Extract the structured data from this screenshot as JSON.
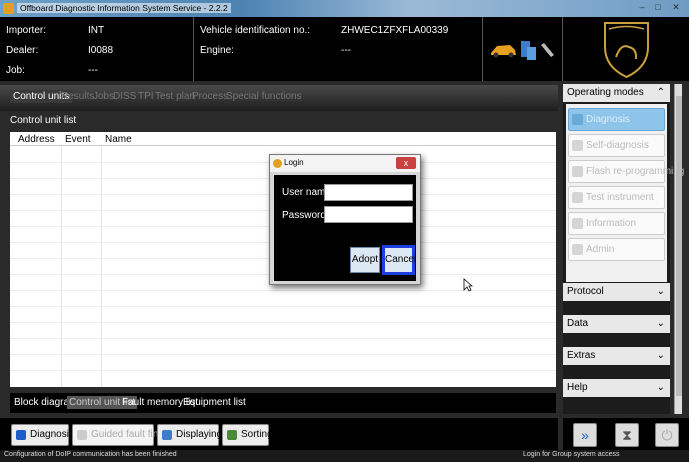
{
  "window": {
    "title": "Offboard Diagnostic Information System Service - 2.2.2"
  },
  "info": {
    "importer_label": "Importer:",
    "importer_value": "INT",
    "dealer_label": "Dealer:",
    "dealer_value": "I0088",
    "job_label": "Job:",
    "job_value": "---",
    "vin_label": "Vehicle identification no.:",
    "vin_value": "ZHWEC1ZFXFLA00339",
    "engine_label": "Engine:",
    "engine_value": "---"
  },
  "main_tabs": [
    {
      "label": "Control units"
    },
    {
      "label": "Results"
    },
    {
      "label": "Jobs"
    },
    {
      "label": "DISS"
    },
    {
      "label": "TPI"
    },
    {
      "label": "Test plan"
    },
    {
      "label": "Process"
    },
    {
      "label": "Special functions"
    }
  ],
  "control_unit_list": {
    "title": "Control unit list",
    "columns": [
      "Address",
      "Event",
      "Name"
    ]
  },
  "bottom_tabs": [
    {
      "label": "Block diagram"
    },
    {
      "label": "Control unit list"
    },
    {
      "label": "Fault memory list"
    },
    {
      "label": "Equipment list"
    }
  ],
  "toolbar": {
    "diagnosis": "Diagnosis",
    "guided_fault_finding": "Guided fault finding",
    "displaying": "Displaying...",
    "sorting": "Sorting..."
  },
  "right_panel": {
    "operating_modes": "Operating modes",
    "modes": [
      {
        "label": "Diagnosis",
        "icon": "diagnosis-icon"
      },
      {
        "label": "Self-diagnosis",
        "icon": "self-diagnosis-icon"
      },
      {
        "label": "Flash re-programming",
        "icon": "flash-icon"
      },
      {
        "label": "Test instrument",
        "icon": "test-instrument-icon"
      },
      {
        "label": "Information",
        "icon": "information-icon"
      },
      {
        "label": "Admin",
        "icon": "admin-icon"
      }
    ],
    "protocol": "Protocol",
    "data": "Data",
    "extras": "Extras",
    "help": "Help"
  },
  "login": {
    "title": "Login",
    "close": "x",
    "username_label": "User name",
    "password_label": "Password",
    "adopt": "Adopt",
    "cancel": "Cancel"
  },
  "status": {
    "left": "Configuration of DoIP communication has been finished",
    "right": "Login for Group system access"
  },
  "colors": {
    "accent": "#1d3ee0",
    "selected_mode": "#8ec4ea",
    "background": "#000000"
  }
}
